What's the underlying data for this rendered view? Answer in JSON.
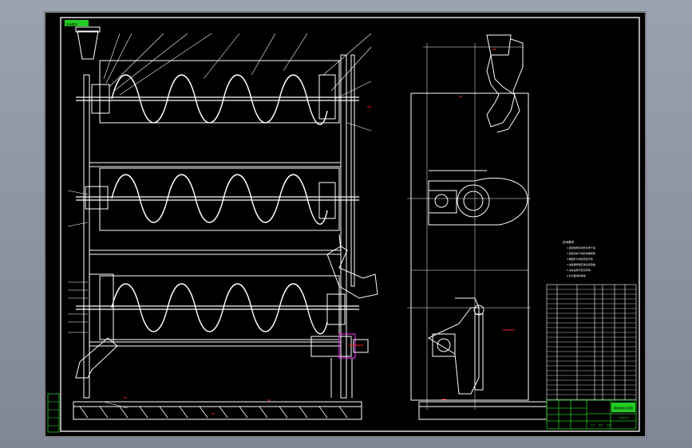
{
  "drawing": {
    "title_tag": "技术要求",
    "notes_heading": "技术要求",
    "notes": [
      "1.装配前所有零件清洗干净",
      "2.各密封处不得有渗漏现象",
      "3.螺旋叶片焊接牢固平整",
      "4.减速器按规定加注润滑油",
      "5.试车运转平稳无异响",
      "6.外表面涂防锈漆"
    ],
    "title_block": {
      "name": "螺旋输送机总装图",
      "code": "LXSSJ-00"
    },
    "revision_labels": [
      "标记",
      "处数",
      "分区"
    ],
    "colors": {
      "line": "#ffffff",
      "background": "#000000",
      "accent_red": "#ff2020",
      "accent_green": "#22cc22",
      "accent_magenta": "#ff30ff"
    }
  }
}
